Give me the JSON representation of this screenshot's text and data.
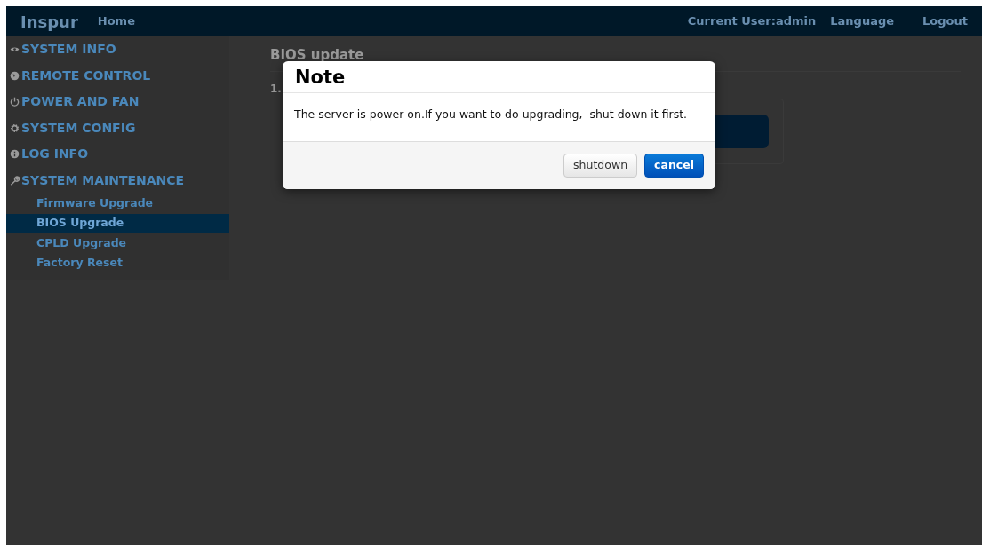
{
  "navbar": {
    "brand": "Inspur",
    "home": "Home",
    "current_user": "Current User:admin",
    "language": "Language",
    "logout": "Logout"
  },
  "sidebar": {
    "items": [
      {
        "label": "SYSTEM INFO",
        "kind": "eye"
      },
      {
        "label": "REMOTE CONTROL",
        "kind": "globe"
      },
      {
        "label": "POWER AND FAN",
        "kind": "power"
      },
      {
        "label": "SYSTEM CONFIG",
        "kind": "gear"
      },
      {
        "label": "LOG INFO",
        "kind": "info"
      },
      {
        "label": "SYSTEM MAINTENANCE",
        "kind": "wrench",
        "children": [
          {
            "label": "Firmware Upgrade",
            "selected": false
          },
          {
            "label": "BIOS Upgrade",
            "selected": true
          },
          {
            "label": "CPLD Upgrade",
            "selected": false
          },
          {
            "label": "Factory Reset",
            "selected": false
          }
        ]
      }
    ]
  },
  "main": {
    "title": "BIOS update",
    "step": "1."
  },
  "modal": {
    "title": "Note",
    "message": "The server is power on.If you want to do upgrading,  shut down it first.",
    "buttons": [
      {
        "label": "shutdown",
        "kind": "default"
      },
      {
        "label": "cancel",
        "kind": "primary"
      }
    ]
  }
}
